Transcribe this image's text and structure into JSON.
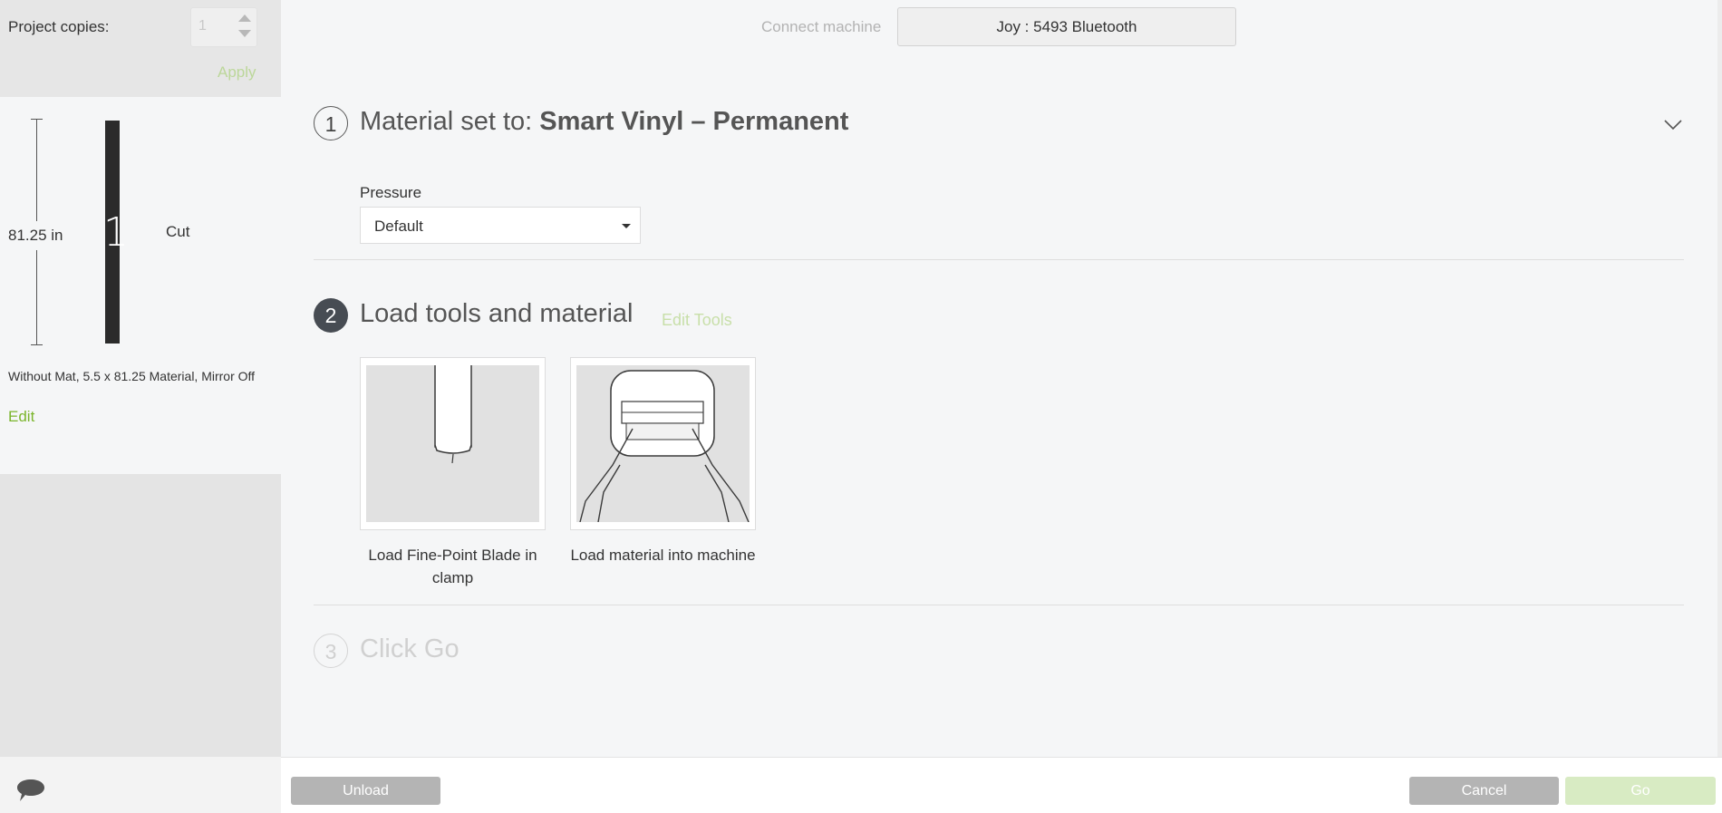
{
  "copies": {
    "label": "Project copies:",
    "value": "1",
    "apply": "Apply"
  },
  "mat": {
    "length": "81.25 in",
    "number": "1",
    "mode": "Cut",
    "info": "Without Mat, 5.5 x 81.25 Material, Mirror Off",
    "edit": "Edit"
  },
  "header": {
    "connect_label": "Connect machine",
    "machine": "Joy : 5493 Bluetooth"
  },
  "step1": {
    "number": "1",
    "prefix": "Material set to: ",
    "material": "Smart Vinyl – Permanent",
    "pressure_label": "Pressure",
    "pressure_value": "Default"
  },
  "step2": {
    "number": "2",
    "title": "Load tools and material",
    "edit_tools": "Edit Tools",
    "cards": [
      {
        "label": "Load Fine-Point Blade in clamp"
      },
      {
        "label": "Load material into machine"
      }
    ]
  },
  "step3": {
    "number": "3",
    "title": "Click Go"
  },
  "footer": {
    "unload": "Unload",
    "cancel": "Cancel",
    "go": "Go"
  },
  "colors": {
    "accent_green": "#7bb52c",
    "disabled_green": "#d8ebc3",
    "button_gray": "#b4b4b4",
    "step_active": "#474c53"
  }
}
